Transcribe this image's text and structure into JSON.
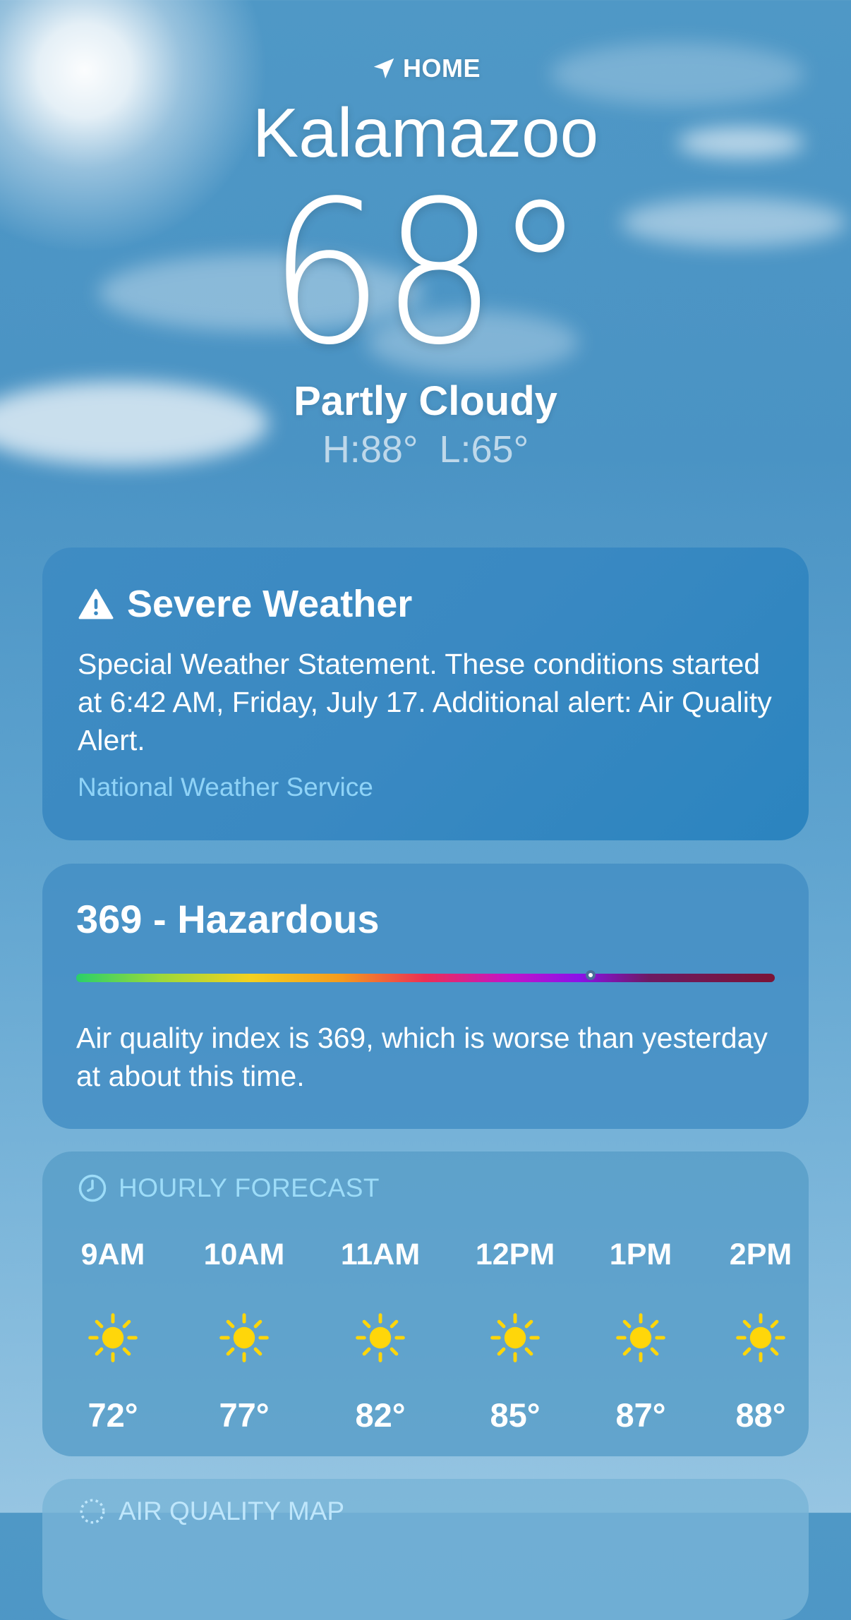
{
  "location": {
    "label": "HOME",
    "city": "Kalamazoo",
    "temperature": "68°",
    "condition": "Partly Cloudy",
    "high": "H:88°",
    "low": "L:65°"
  },
  "alert": {
    "title": "Severe Weather",
    "body": "Special Weather Statement. These conditions started at 6:42 AM, Friday, July 17. Additional alert: Air Quality Alert.",
    "source": "National Weather Service",
    "icon": "warning-triangle-icon"
  },
  "air_quality": {
    "title": "369 - Hazardous",
    "description": "Air quality index is 369, which is worse than yesterday at about this time.",
    "scale_position_fraction": 0.736
  },
  "hourly": {
    "heading": "HOURLY FORECAST",
    "icon": "clock-icon",
    "items": [
      {
        "time": "9AM",
        "icon": "sun-icon",
        "temp": "72°"
      },
      {
        "time": "10AM",
        "icon": "sun-icon",
        "temp": "77°"
      },
      {
        "time": "11AM",
        "icon": "sun-icon",
        "temp": "82°"
      },
      {
        "time": "12PM",
        "icon": "sun-icon",
        "temp": "85°"
      },
      {
        "time": "1PM",
        "icon": "sun-icon",
        "temp": "87°"
      },
      {
        "time": "2PM",
        "icon": "sun-icon",
        "temp": "88°"
      }
    ]
  },
  "map": {
    "heading": "AIR QUALITY MAP"
  },
  "colors": {
    "sun_yellow": "#FFD60A",
    "accent_cyan": "#8FD3F7"
  }
}
